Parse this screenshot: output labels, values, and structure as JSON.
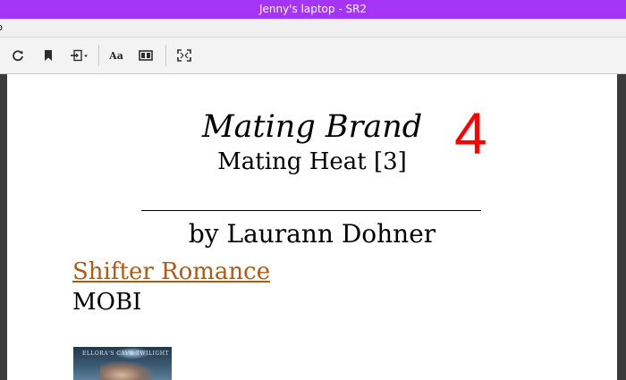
{
  "window": {
    "title": "Jenny's laptop - SR2"
  },
  "menubar": {
    "fragment": "p"
  },
  "toolbar": {
    "items": [
      {
        "name": "refresh-icon"
      },
      {
        "name": "bookmark-icon"
      },
      {
        "name": "import-dropdown-icon"
      },
      {
        "name": "font-size-button",
        "label": "Aa"
      },
      {
        "name": "layout-icon"
      },
      {
        "name": "fullscreen-icon"
      }
    ]
  },
  "book": {
    "title": "Mating Brand",
    "series": "Mating Heat [3]",
    "number": "4",
    "author": "by Laurann Dohner",
    "genre": "Shifter Romance",
    "format": "MOBI",
    "cover_text": "ELLORA'S CAVE TWILIGHT"
  },
  "colors": {
    "titlebar": "#a434f6",
    "number": "#ff0000",
    "genre_link": "#b05a14"
  }
}
